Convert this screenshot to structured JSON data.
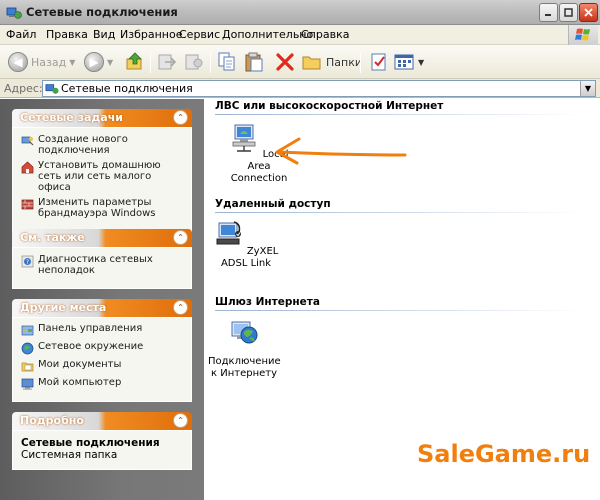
{
  "window": {
    "title": "Сетевые подключения"
  },
  "menu": [
    {
      "label": "Файл"
    },
    {
      "label": "Правка"
    },
    {
      "label": "Вид"
    },
    {
      "label": "Избранное"
    },
    {
      "label": "Сервис"
    },
    {
      "label": "Дополнительно"
    },
    {
      "label": "Справка"
    }
  ],
  "toolbar": {
    "back_label": "Назад",
    "folders_label": "Папки"
  },
  "address": {
    "label": "Адрес:",
    "value": "Сетевые подключения"
  },
  "left_panels": {
    "tasks": {
      "title": "Сетевые задачи",
      "items": [
        {
          "label": "Создание нового подключения",
          "icon": "new-connection-icon"
        },
        {
          "label": "Установить домашнюю сеть или сеть малого офиса",
          "icon": "home-network-icon"
        },
        {
          "label": "Изменить параметры брандмауэра Windows",
          "icon": "firewall-icon"
        }
      ]
    },
    "see_also": {
      "title": "См. также",
      "items": [
        {
          "label": "Диагностика сетевых неполадок",
          "icon": "help-icon"
        }
      ]
    },
    "other_places": {
      "title": "Другие места",
      "items": [
        {
          "label": "Панель управления",
          "icon": "control-panel-icon"
        },
        {
          "label": "Сетевое окружение",
          "icon": "network-places-icon"
        },
        {
          "label": "Мои документы",
          "icon": "documents-icon"
        },
        {
          "label": "Мой компьютер",
          "icon": "computer-icon"
        }
      ]
    },
    "details": {
      "title": "Подробно",
      "name": "Сетевые подключения",
      "type": "Системная папка"
    }
  },
  "content": {
    "groups": [
      {
        "title": "ЛВС или высокоскоростной Интернет",
        "items": [
          {
            "label": "Local Area Connection",
            "icon": "lan-connection-icon"
          }
        ]
      },
      {
        "title": "Удаленный доступ",
        "items": [
          {
            "label": "ZyXEL ADSL Link",
            "icon": "dialup-connection-icon"
          }
        ]
      },
      {
        "title": "Шлюз Интернета",
        "items": [
          {
            "label": "Подключение к Интернету",
            "icon": "internet-gateway-icon"
          }
        ]
      }
    ]
  },
  "annotation": {
    "color": "#f07f0e"
  },
  "watermark": "SaleGame.ru"
}
